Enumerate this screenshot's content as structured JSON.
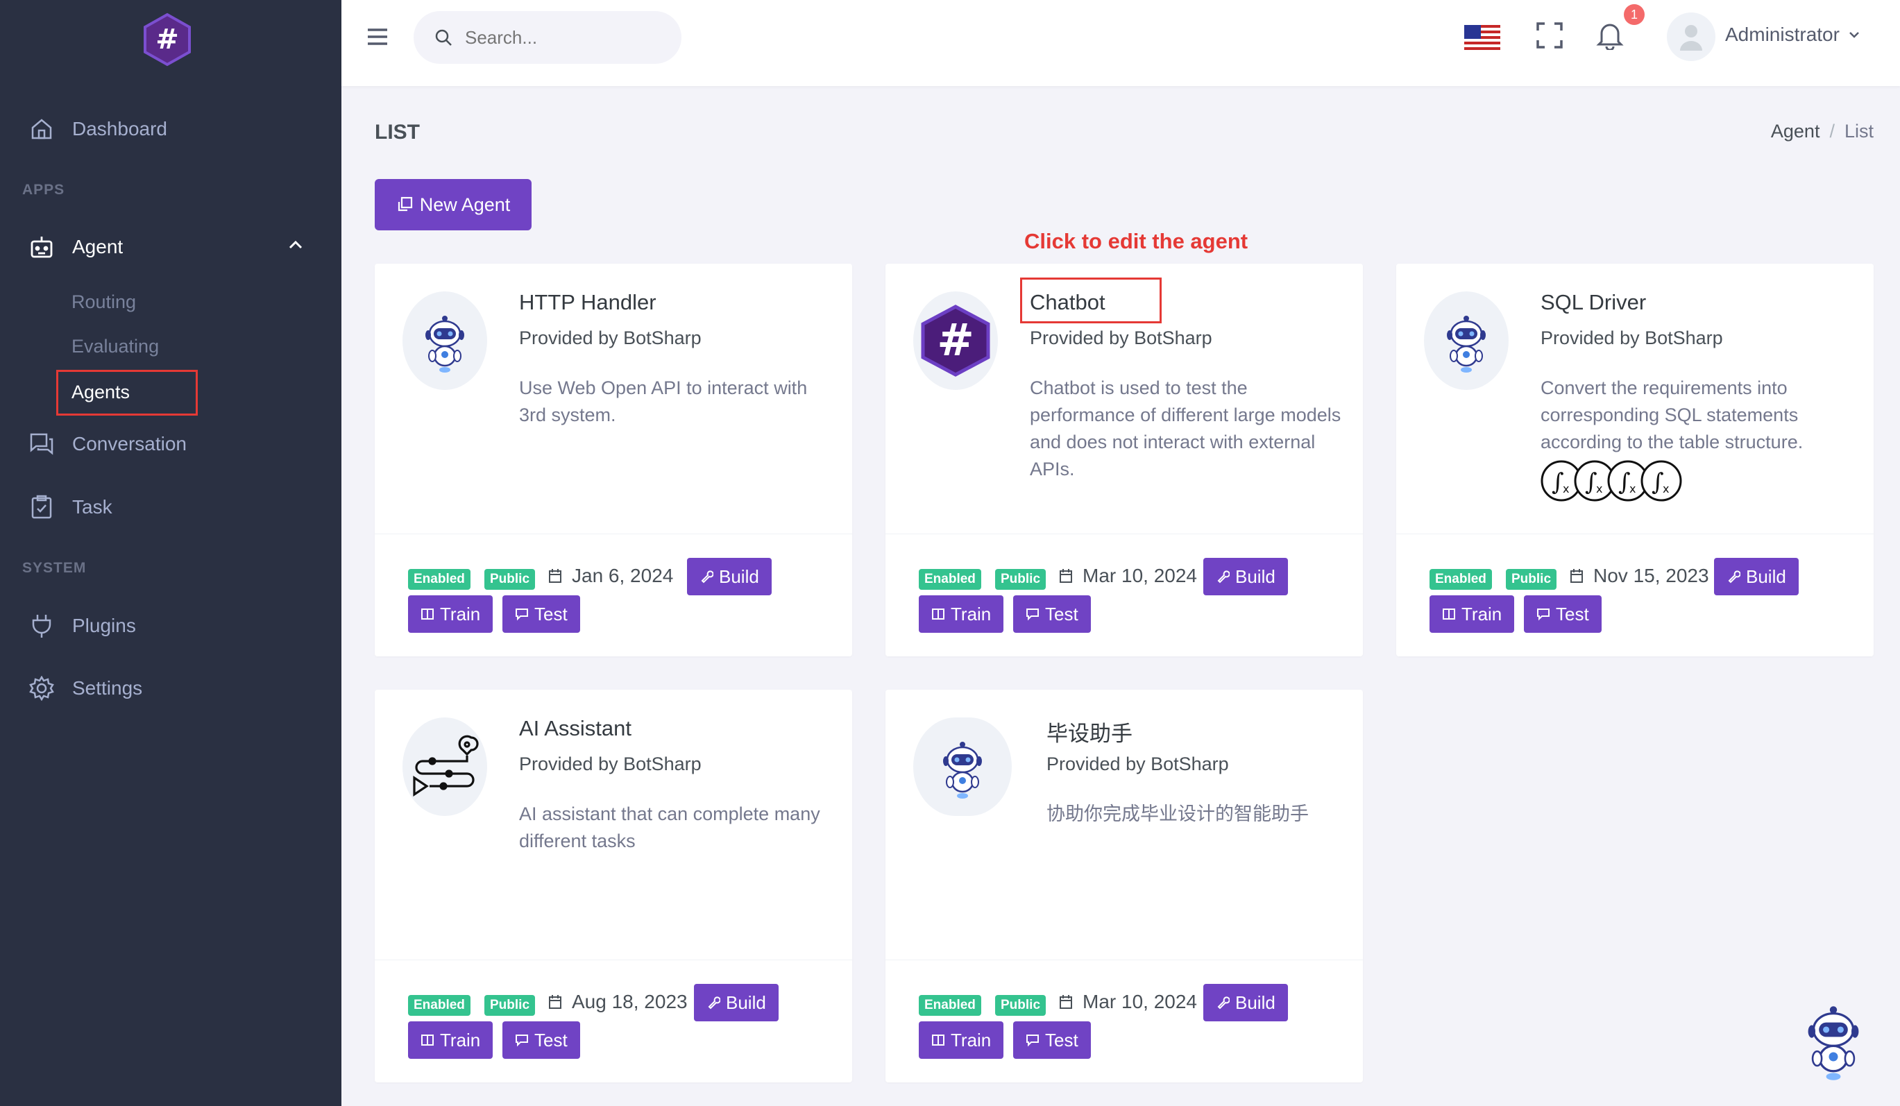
{
  "sidebar": {
    "dashboard": "Dashboard",
    "apps_title": "APPS",
    "agent": "Agent",
    "sub_items": [
      "Routing",
      "Evaluating",
      "Agents"
    ],
    "conversation": "Conversation",
    "task": "Task",
    "system_title": "SYSTEM",
    "plugins": "Plugins",
    "settings": "Settings"
  },
  "topbar": {
    "search_placeholder": "Search...",
    "notification_count": "1",
    "user_name": "Administrator"
  },
  "page": {
    "title": "LIST",
    "breadcrumb": [
      "Agent",
      "/",
      "List"
    ],
    "new_agent_label": "New Agent",
    "annotation": "Click to edit the agent"
  },
  "badges": {
    "enabled": "Enabled",
    "public": "Public"
  },
  "buttons": {
    "build": "Build",
    "train": "Train",
    "test": "Test"
  },
  "agents": [
    {
      "name": "HTTP Handler",
      "provider": "Provided by BotSharp",
      "description": "Use Web Open API to interact with 3rd system.",
      "date": "Jan 6, 2024",
      "icon": "robot-icon"
    },
    {
      "name": "Chatbot",
      "provider": "Provided by BotSharp",
      "description": "Chatbot is used to test the performance of different large models and does not interact with external APIs.",
      "date": "Mar 10, 2024",
      "icon": "hashtag-logo-icon"
    },
    {
      "name": "SQL Driver",
      "provider": "Provided by BotSharp",
      "description": "Convert the requirements into corresponding SQL statements according to the table structure.",
      "date": "Nov 15, 2023",
      "icon": "robot-icon"
    },
    {
      "name": "AI Assistant",
      "provider": "Provided by BotSharp",
      "description": "AI assistant that can complete many different tasks",
      "date": "Aug 18, 2023",
      "icon": "route-icon"
    },
    {
      "name": "毕设助手",
      "provider": "Provided by BotSharp",
      "description": "协助你完成毕业设计的智能助手",
      "date": "Mar 10, 2024",
      "icon": "robot-icon"
    }
  ],
  "colors": {
    "sidebar_bg": "#2a3042",
    "primary": "#7043c4",
    "success": "#34c38f",
    "annotation": "#e53935"
  }
}
